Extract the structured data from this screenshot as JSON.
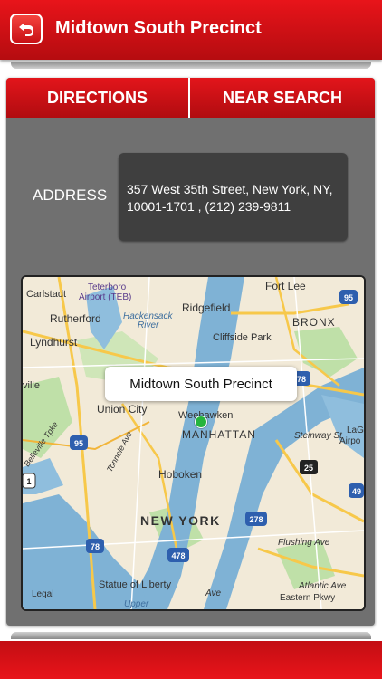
{
  "header": {
    "title": "Midtown South Precinct",
    "back_icon": "back-arrow-icon"
  },
  "tabs": [
    {
      "label": "DIRECTIONS"
    },
    {
      "label": "NEAR SEARCH"
    }
  ],
  "address": {
    "label": "ADDRESS",
    "value": "357 West 35th Street, New York, NY, 10001-1701 , (212) 239-9811"
  },
  "map": {
    "callout": "Midtown South Precinct",
    "labels": [
      "Carlstadt",
      "Teterboro",
      "Airport (TEB)",
      "Rutherford",
      "Hackensack",
      "River",
      "Ridgefield",
      "Fort Lee",
      "BRONX",
      "Lyndhurst",
      "Cliffside Park",
      "ville",
      "Union City",
      "Weehawken",
      "MANHATTAN",
      "Hoboken",
      "NEW YORK",
      "Flushing Ave",
      "Statue of Liberty",
      "Legal",
      "Eastern Pkwy",
      "Atlantic Ave",
      "Steinway St",
      "LaG",
      "Airpo",
      "Tonnele Ave",
      "Belleville Tpke",
      "Upper",
      "Ave"
    ],
    "shields": [
      "95",
      "78",
      "95",
      "25",
      "278",
      "478",
      "78",
      "1",
      "49"
    ],
    "colors": {
      "land": "#f2ead8",
      "water": "#7fb2d5",
      "park": "#bfe0a8",
      "highway": "#f7c84a"
    }
  },
  "colors": {
    "brand_red": "#d81218",
    "panel_gray": "#707070",
    "address_box": "#3f3f3f",
    "pin_green": "#26b43d"
  }
}
